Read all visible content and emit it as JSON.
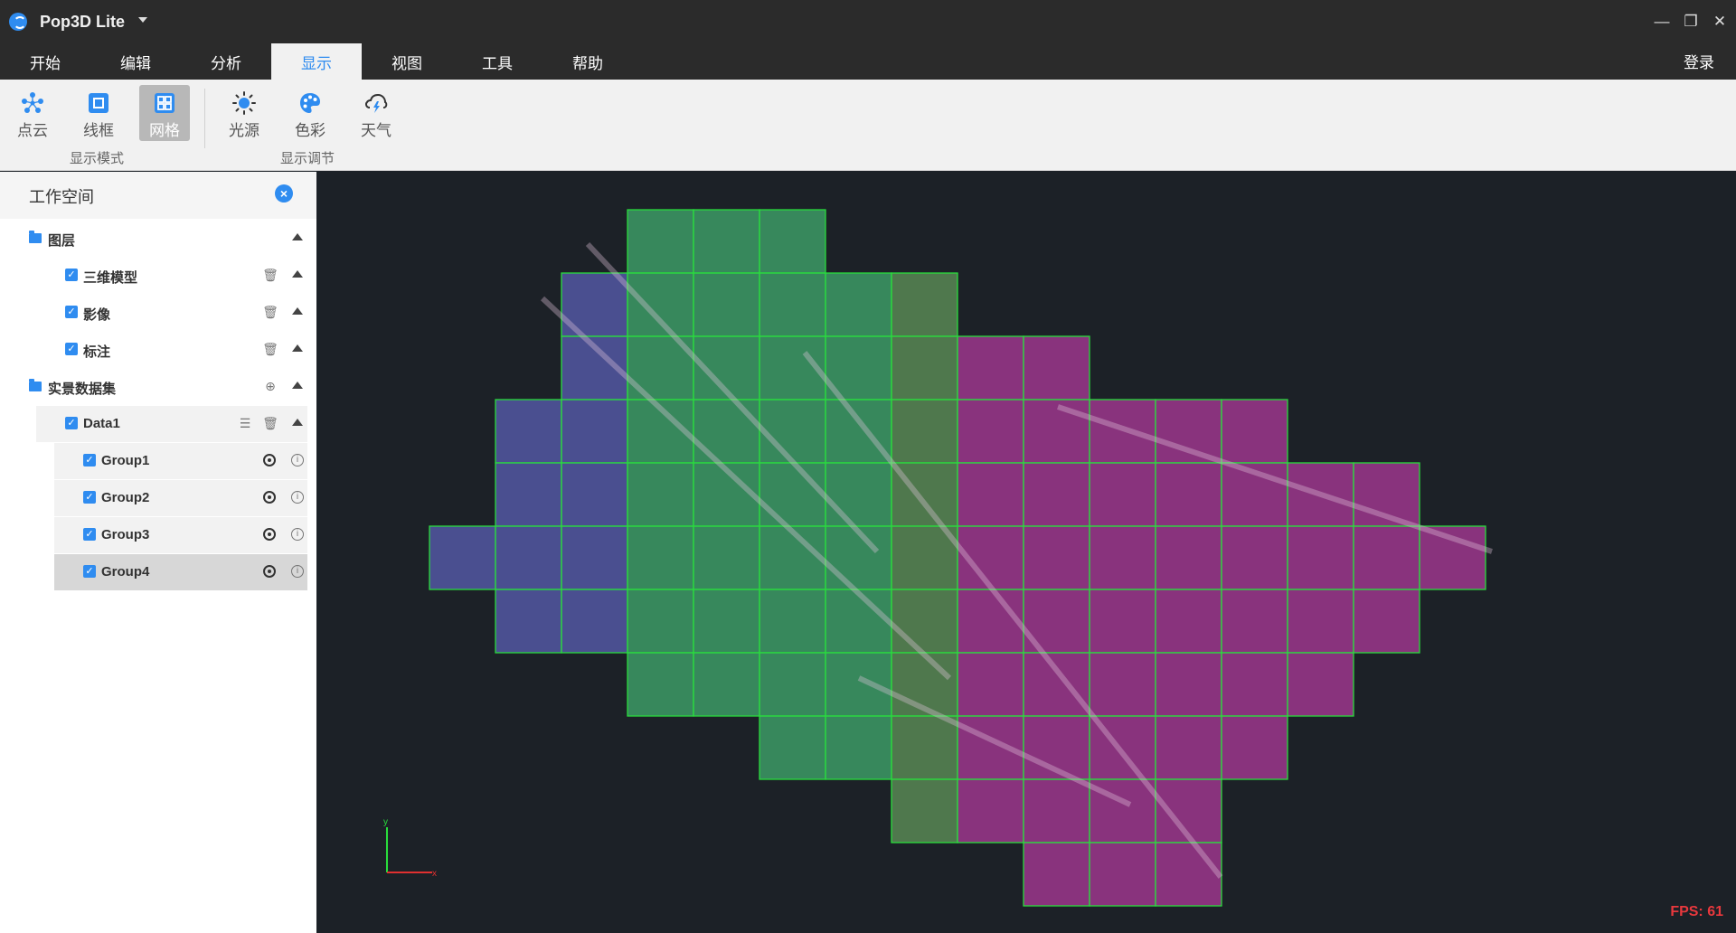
{
  "app": {
    "title": "Pop3D Lite"
  },
  "window_controls": {
    "minimize": "—",
    "restore": "❐",
    "close": "✕"
  },
  "menu": {
    "tabs": [
      "开始",
      "编辑",
      "分析",
      "显示",
      "视图",
      "工具",
      "帮助"
    ],
    "active_index": 3,
    "login": "登录"
  },
  "ribbon": {
    "buttons": [
      {
        "label": "点云",
        "icon": "point-cloud-icon"
      },
      {
        "label": "线框",
        "icon": "wireframe-icon"
      },
      {
        "label": "网格",
        "icon": "mesh-icon",
        "active": true
      },
      {
        "label": "光源",
        "icon": "light-icon"
      },
      {
        "label": "色彩",
        "icon": "palette-icon"
      },
      {
        "label": "天气",
        "icon": "weather-icon"
      }
    ],
    "groups": [
      "显示模式",
      "显示调节"
    ]
  },
  "workspace": {
    "title": "工作空间",
    "tree": {
      "layers_label": "图层",
      "layers": [
        "三维模型",
        "影像",
        "标注"
      ],
      "dataset_label": "实景数据集",
      "data_label": "Data1",
      "groups": [
        "Group1",
        "Group2",
        "Group3",
        "Group4"
      ],
      "selected_group": "Group4"
    }
  },
  "viewport": {
    "fps": "FPS: 61",
    "axis_x_label": "x",
    "axis_y_label": "y",
    "colors": {
      "green": "#28dc3c",
      "magenta": "#b43aa0",
      "blue": "#5a5fb4"
    }
  }
}
